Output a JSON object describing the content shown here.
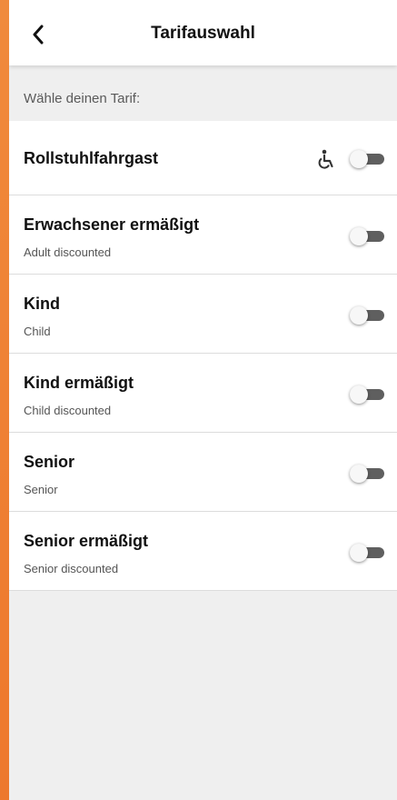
{
  "header": {
    "title": "Tarifauswahl"
  },
  "section_label": "Wähle deinen Tarif:",
  "tariffs": [
    {
      "title": "Rollstuhlfahrgast",
      "subtitle": "",
      "icon": "wheelchair-icon",
      "enabled": false
    },
    {
      "title": "Erwachsener ermäßigt",
      "subtitle": "Adult discounted",
      "enabled": false
    },
    {
      "title": "Kind",
      "subtitle": "Child",
      "enabled": false
    },
    {
      "title": "Kind ermäßigt",
      "subtitle": "Child discounted",
      "enabled": false
    },
    {
      "title": "Senior",
      "subtitle": "Senior",
      "enabled": false
    },
    {
      "title": "Senior ermäßigt",
      "subtitle": "Senior discounted",
      "enabled": false
    }
  ],
  "colors": {
    "accent_background": "#ee7a2e",
    "toggle_track": "#5f5f5f"
  }
}
